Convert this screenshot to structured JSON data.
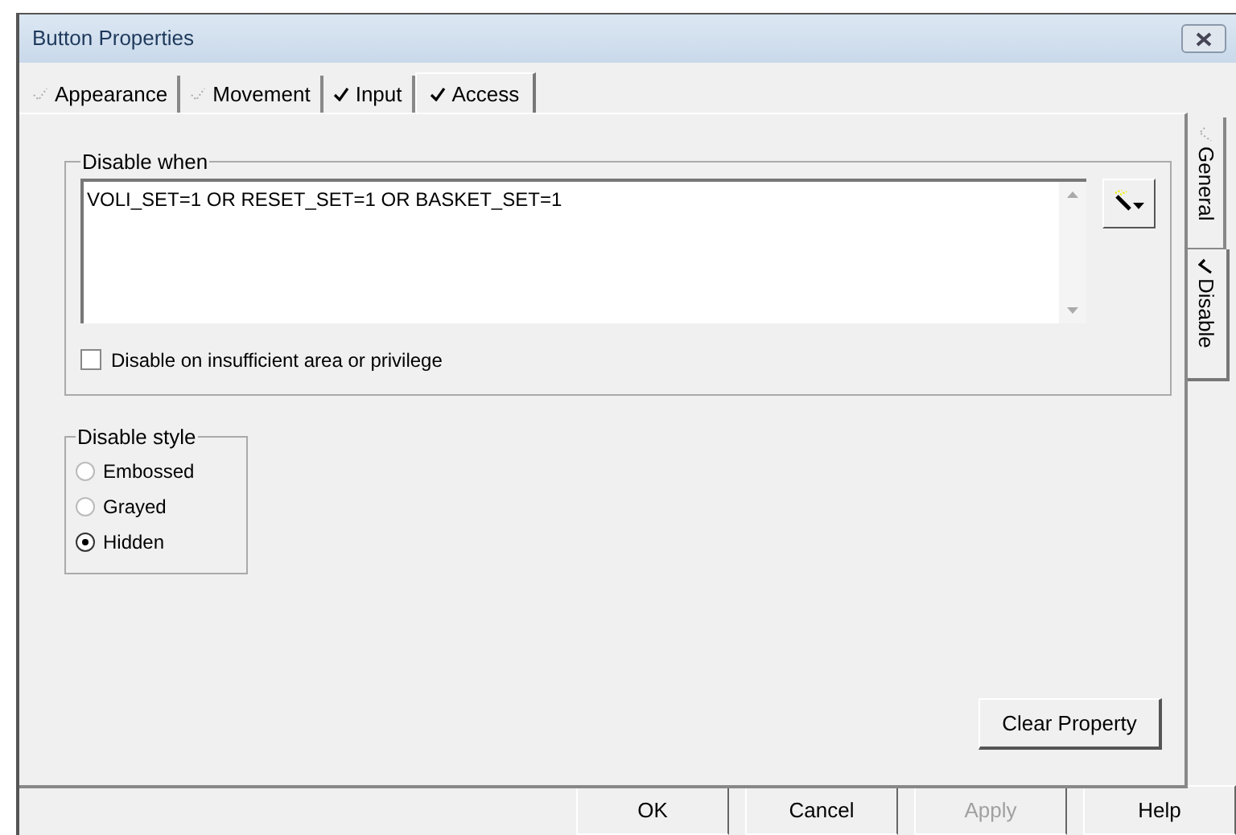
{
  "window": {
    "title": "Button Properties"
  },
  "tabs": [
    {
      "label": "Appearance",
      "checked": false,
      "selected": false
    },
    {
      "label": "Movement",
      "checked": false,
      "selected": false
    },
    {
      "label": "Input",
      "checked": true,
      "selected": false
    },
    {
      "label": "Access",
      "checked": true,
      "selected": true
    }
  ],
  "side_tabs": [
    {
      "label": "General",
      "checked": false,
      "selected": false
    },
    {
      "label": "Disable",
      "checked": true,
      "selected": true
    }
  ],
  "disable_when": {
    "title": "Disable when",
    "expression": "VOLI_SET=1 OR RESET_SET=1 OR BASKET_SET=1",
    "checkbox": {
      "label": "Disable on insufficient area or privilege",
      "checked": false
    }
  },
  "disable_style": {
    "title": "Disable style",
    "options": [
      {
        "label": "Embossed",
        "selected": false
      },
      {
        "label": "Grayed",
        "selected": false
      },
      {
        "label": "Hidden",
        "selected": true
      }
    ]
  },
  "clear_button": "Clear Property",
  "buttons": [
    {
      "label": "OK",
      "disabled": false
    },
    {
      "label": "Cancel",
      "disabled": false
    },
    {
      "label": "Apply",
      "disabled": true
    },
    {
      "label": "Help",
      "disabled": false
    }
  ]
}
